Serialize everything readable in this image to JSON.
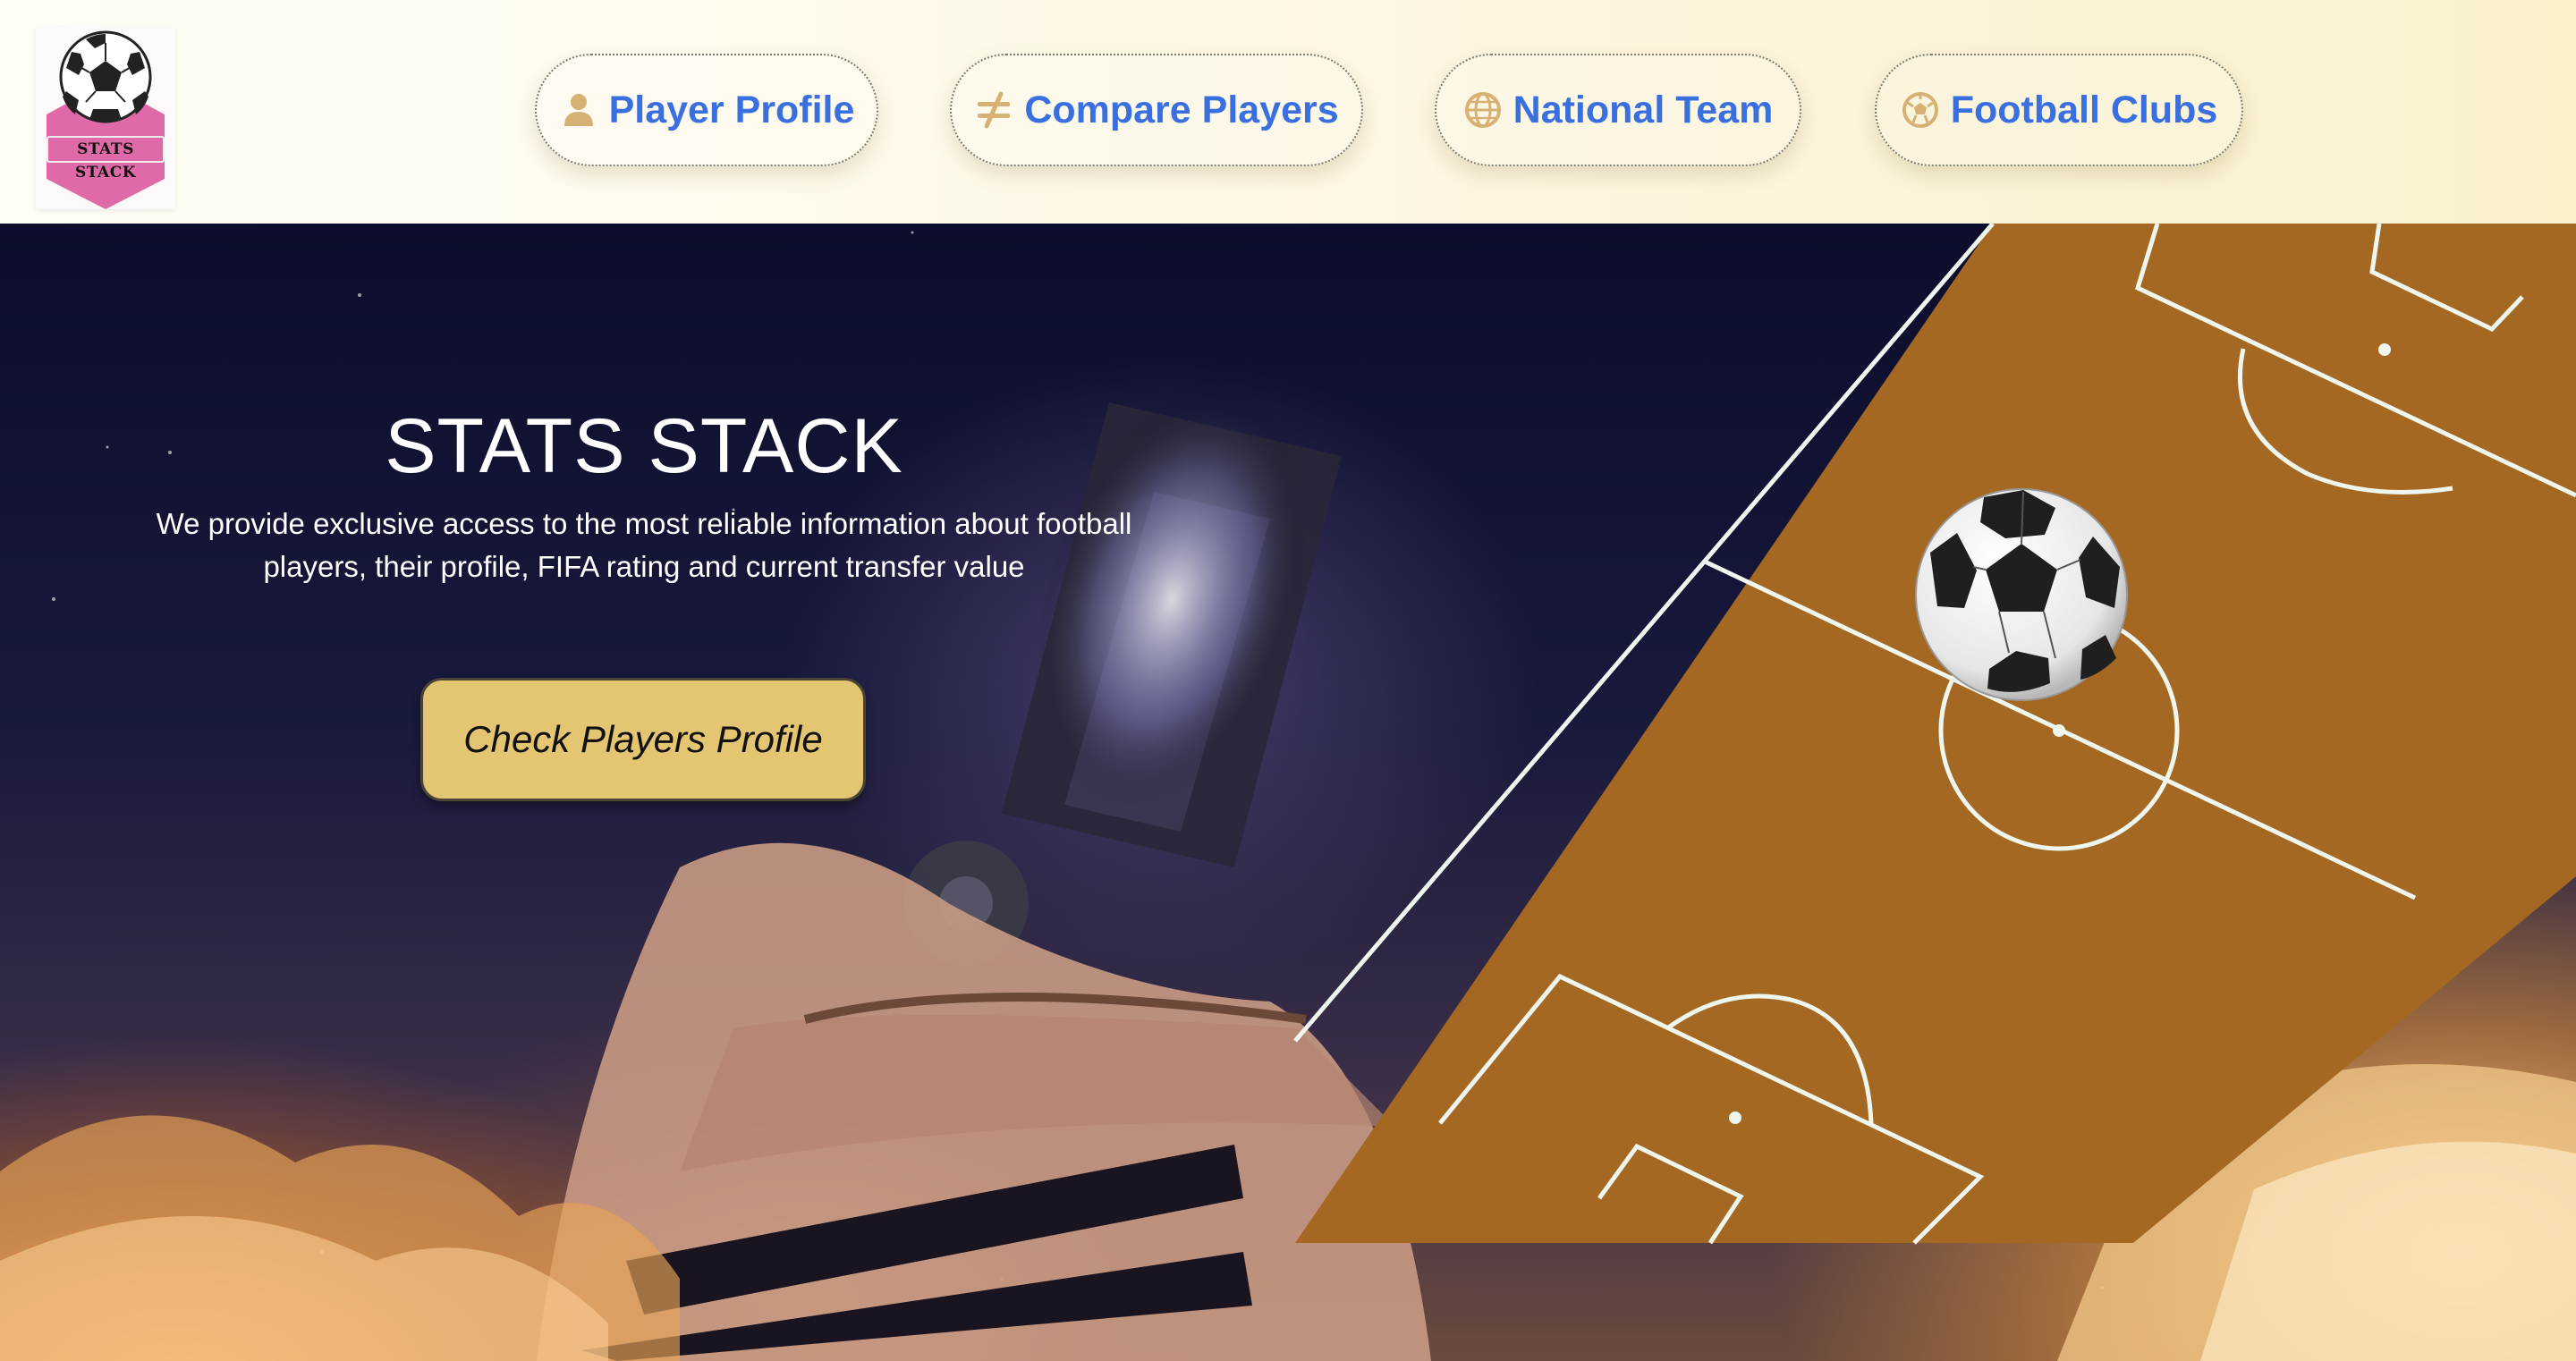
{
  "brand": {
    "logo_text": "STATS STACK",
    "logo_color": "#e06aa8"
  },
  "nav": {
    "items": [
      {
        "label": "Player Profile",
        "icon": "user-icon"
      },
      {
        "label": "Compare Players",
        "icon": "not-equal-icon"
      },
      {
        "label": "National Team",
        "icon": "globe-icon"
      },
      {
        "label": "Football Clubs",
        "icon": "football-icon"
      }
    ],
    "label_color": "#3a6fe0",
    "icon_color": "#d7b174"
  },
  "hero": {
    "title": "STATS STACK",
    "description": "We provide exclusive access to the most reliable information about football players, their profile, FIFA rating and current transfer value",
    "cta_label": "Check Players Profile",
    "cta_color": "#e4c572",
    "pitch_color": "#a56823"
  }
}
